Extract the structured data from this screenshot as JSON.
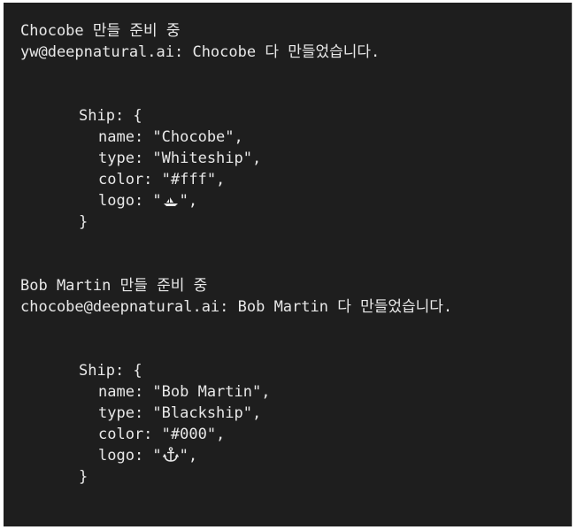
{
  "blocks": [
    {
      "prep_line": "Chocobe 만들 준비 중",
      "done_line": "yw@deepnatural.ai: Chocobe 다 만들었습니다.",
      "ship_open": "Ship: {",
      "name_line": "name: \"Chocobe\",",
      "type_line": "type: \"Whiteship\",",
      "color_line": "color: \"#fff\",",
      "logo_prefix": "logo: \"",
      "logo_icon": "ship-icon",
      "logo_suffix": "\",",
      "ship_close": "}"
    },
    {
      "prep_line": "Bob Martin 만들 준비 중",
      "done_line": "chocobe@deepnatural.ai: Bob Martin 다 만들었습니다.",
      "ship_open": "Ship: {",
      "name_line": "name: \"Bob Martin\",",
      "type_line": "type: \"Blackship\",",
      "color_line": "color: \"#000\",",
      "logo_prefix": "logo: \"",
      "logo_icon": "anchor-icon",
      "logo_suffix": "\",",
      "ship_close": "}"
    }
  ],
  "colors": {
    "background": "#1e1e1e",
    "text": "#e8e8e8"
  }
}
